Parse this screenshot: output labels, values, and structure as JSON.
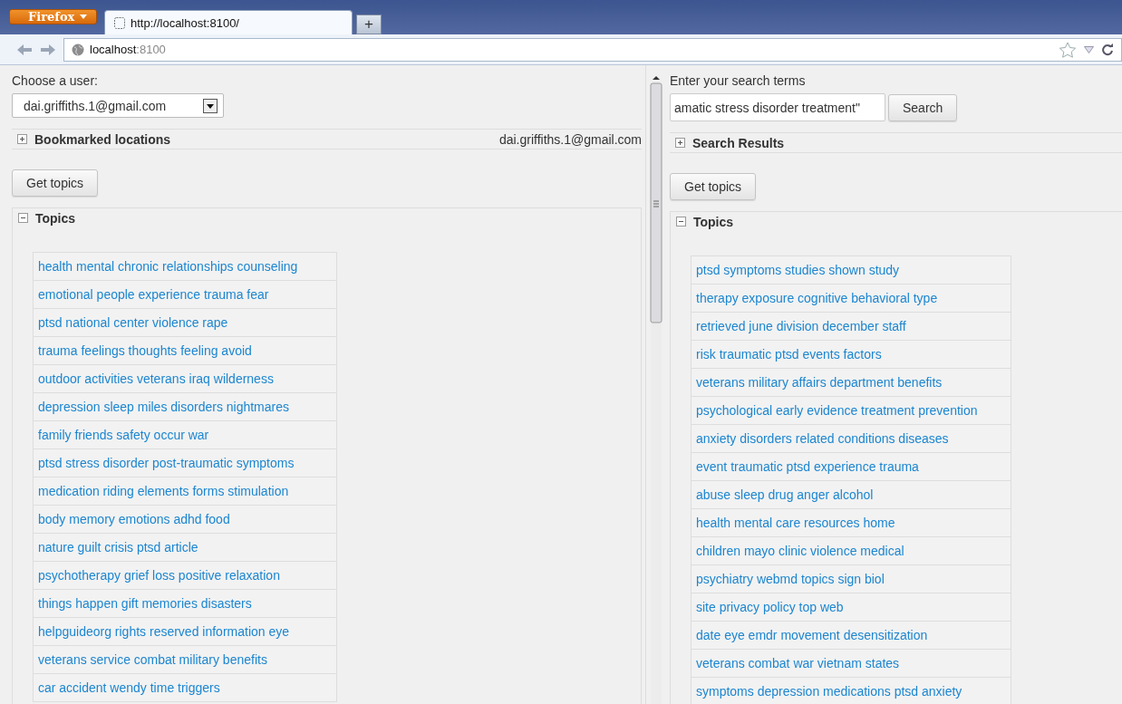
{
  "browser": {
    "menu_button": "Firefox",
    "tab_title": "http://localhost:8100/",
    "new_tab": "+",
    "address": {
      "host": "localhost",
      "port": ":8100"
    }
  },
  "left": {
    "user_label": "Choose a user:",
    "user_select": "dai.griffiths.1@gmail.com",
    "bookmarks": {
      "title": "Bookmarked locations",
      "expanded": false,
      "user": "dai.griffiths.1@gmail.com"
    },
    "get_topics": "Get topics",
    "topics": {
      "title": "Topics",
      "expanded": true,
      "items": [
        "health mental chronic relationships counseling",
        "emotional people experience trauma fear",
        "ptsd national center violence rape",
        "trauma feelings thoughts feeling avoid",
        "outdoor activities veterans iraq wilderness",
        "depression sleep miles disorders nightmares",
        "family friends safety occur war",
        "ptsd stress disorder post-traumatic symptoms",
        "medication riding elements forms stimulation",
        "body memory emotions adhd food",
        "nature guilt crisis ptsd article",
        "psychotherapy grief loss positive relaxation",
        "things happen gift memories disasters",
        "helpguideorg rights reserved information eye",
        "veterans service combat military benefits",
        "car accident wendy time triggers"
      ]
    }
  },
  "right": {
    "search_label": "Enter your search terms",
    "search_value": "amatic stress disorder treatment\"",
    "search_button": "Search",
    "results": {
      "title": "Search Results",
      "expanded": false
    },
    "get_topics": "Get topics",
    "topics": {
      "title": "Topics",
      "expanded": true,
      "items": [
        "ptsd symptoms studies shown study",
        "therapy exposure cognitive behavioral type",
        "retrieved june division december staff",
        "risk traumatic ptsd events factors",
        "veterans military affairs department benefits",
        "psychological early evidence treatment prevention",
        "anxiety disorders related conditions diseases",
        "event traumatic ptsd experience trauma",
        "abuse sleep drug anger alcohol",
        "health mental care resources home",
        "children mayo clinic violence medical",
        "psychiatry webmd topics sign biol",
        "site privacy policy top web",
        "date eye emdr movement desensitization",
        "veterans combat war vietnam states",
        "symptoms depression medications ptsd anxiety"
      ]
    }
  }
}
